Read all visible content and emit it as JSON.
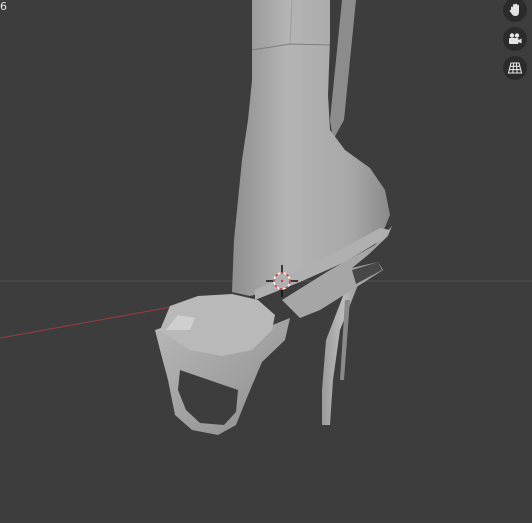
{
  "viewport": {
    "corner_label": "6",
    "background_color": "#3d3d3d",
    "floor_line_color": "#5a4a44",
    "x_axis_color": "#9b3b45",
    "model_color": "#a9a9a9"
  },
  "navigation": {
    "buttons": [
      {
        "name": "pan-view",
        "icon": "hand-icon"
      },
      {
        "name": "camera-view",
        "icon": "camera-icon"
      },
      {
        "name": "perspective-toggle",
        "icon": "grid-icon"
      }
    ]
  },
  "cursor_3d": {
    "icon": "3d-cursor-icon",
    "colors": [
      "#d83a3a",
      "#ffffff"
    ]
  }
}
